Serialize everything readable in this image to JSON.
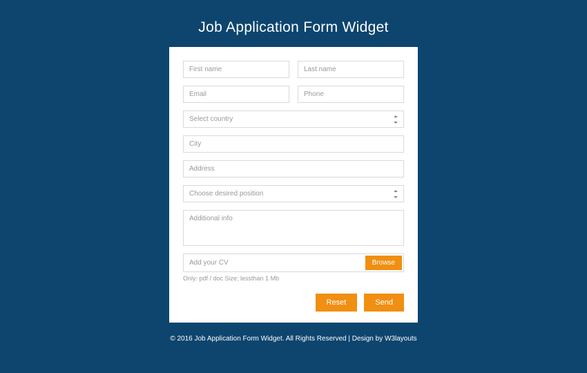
{
  "title": "Job Application Form Widget",
  "form": {
    "first_name_placeholder": "First name",
    "last_name_placeholder": "Last name",
    "email_placeholder": "Email",
    "phone_placeholder": "Phone",
    "country_placeholder": "Select country",
    "city_placeholder": "City",
    "address_placeholder": "Address",
    "position_placeholder": "Choose desired position",
    "info_placeholder": "Additional info",
    "cv_label": "Add your CV",
    "browse_label": "Browse",
    "cv_hint": "Only: pdf / doc Size; lessthan 1 Mb",
    "reset_label": "Reset",
    "send_label": "Send"
  },
  "footer": "© 2016 Job Application Form Widget. All Rights Reserved | Design by W3layouts"
}
